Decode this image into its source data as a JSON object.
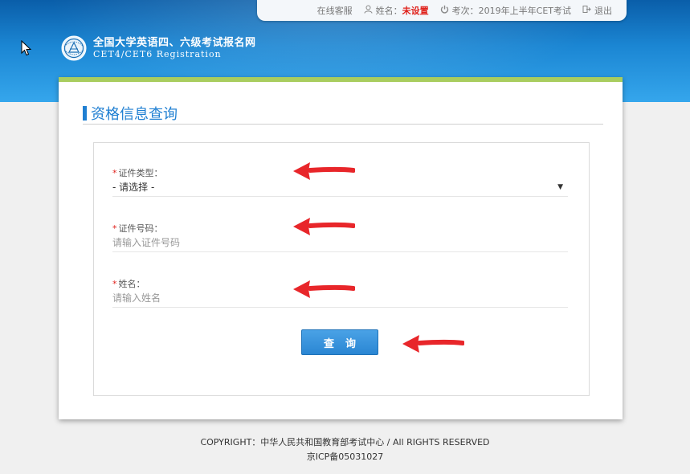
{
  "topbar": {
    "service": "在线客服",
    "name_label": "姓名：",
    "name_value": "未设置",
    "exam_label": "考次：",
    "exam_value": "2019年上半年CET考试",
    "logout": "退出"
  },
  "logo": {
    "title": "全国大学英语四、六级考试报名网",
    "subtitle": "CET4/CET6 Registration"
  },
  "page": {
    "title": "资格信息查询"
  },
  "form": {
    "id_type": {
      "label": "证件类型：",
      "value": "- 请选择 -"
    },
    "id_number": {
      "label": "证件号码：",
      "placeholder": "请输入证件号码"
    },
    "name": {
      "label": "姓名：",
      "placeholder": "请输入姓名"
    },
    "submit": "查询"
  },
  "footer": {
    "copyright": "COPYRIGHT：中华人民共和国教育部考试中心 / All RIGHTS RESERVED",
    "icp": "京ICP备05031027"
  },
  "colors": {
    "header_blue": "#1b86d3",
    "accent_blue": "#1f7fd2",
    "green_bar": "#a9cd5f",
    "required_red": "#e0231d",
    "annotation_arrow": "#e8262a"
  },
  "icons": [
    "cursor-arrow",
    "user-icon",
    "power-icon",
    "logout-icon",
    "cet-emblem",
    "dropdown-caret",
    "annotation-arrow"
  ]
}
